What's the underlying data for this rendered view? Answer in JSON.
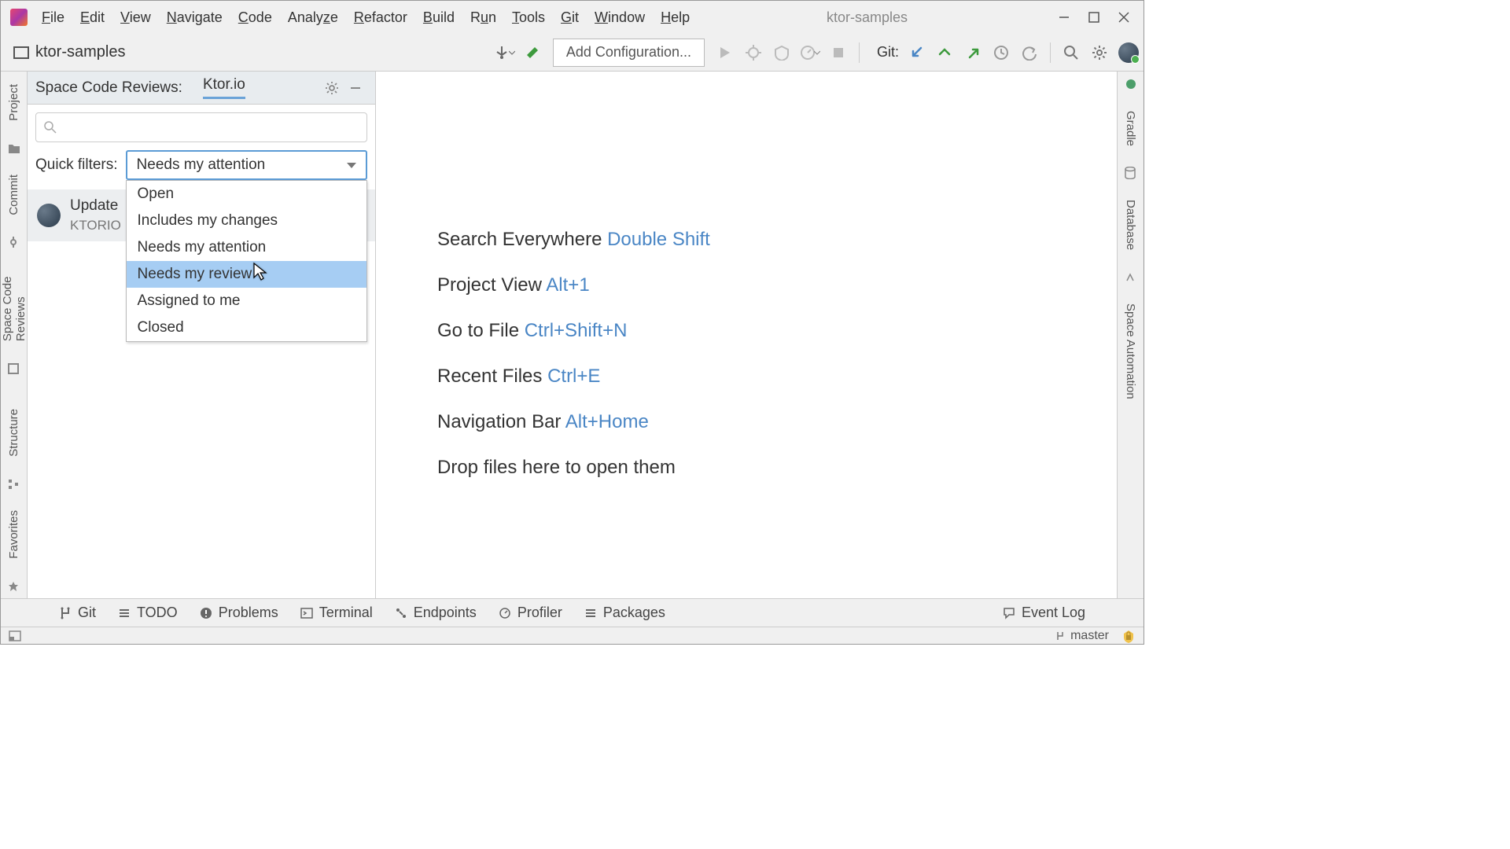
{
  "title": "ktor-samples",
  "menubar": [
    "File",
    "Edit",
    "View",
    "Navigate",
    "Code",
    "Analyze",
    "Refactor",
    "Build",
    "Run",
    "Tools",
    "Git",
    "Window",
    "Help"
  ],
  "navbar": {
    "project": "ktor-samples",
    "add_config": "Add Configuration...",
    "git_label": "Git:"
  },
  "left_strip": [
    "Project",
    "Commit",
    "Space Code Reviews",
    "Structure",
    "Favorites"
  ],
  "right_strip": [
    "Gradle",
    "Database",
    "Space Automation"
  ],
  "panel": {
    "title": "Space Code Reviews:",
    "tab": "Ktor.io",
    "search_placeholder": "",
    "filter_label": "Quick filters:",
    "filter_selected": "Needs my attention",
    "filter_options": [
      "Open",
      "Includes my changes",
      "Needs my attention",
      "Needs my review",
      "Assigned to me",
      "Closed"
    ],
    "filter_highlight_index": 3,
    "review": {
      "title": "Update",
      "subtitle": "KTORIO"
    }
  },
  "welcome": [
    {
      "label": "Search Everywhere",
      "shortcut": "Double Shift"
    },
    {
      "label": "Project View",
      "shortcut": "Alt+1"
    },
    {
      "label": "Go to File",
      "shortcut": "Ctrl+Shift+N"
    },
    {
      "label": "Recent Files",
      "shortcut": "Ctrl+E"
    },
    {
      "label": "Navigation Bar",
      "shortcut": "Alt+Home"
    }
  ],
  "welcome_drop": "Drop files here to open them",
  "bottom": [
    "Git",
    "TODO",
    "Problems",
    "Terminal",
    "Endpoints",
    "Profiler",
    "Packages"
  ],
  "event_log": "Event Log",
  "status": {
    "branch": "master"
  }
}
